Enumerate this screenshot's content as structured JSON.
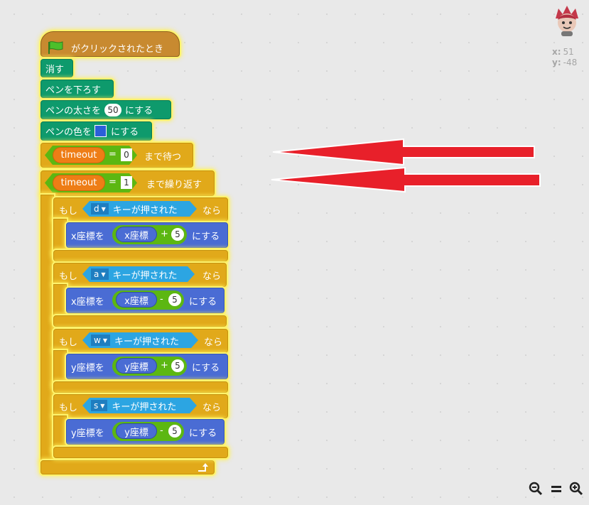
{
  "script": {
    "hat_label": "がクリックされたとき",
    "clear_label": "消す",
    "pen_down_label": "ペンを下ろす",
    "pen_size": {
      "prefix": "ペンの太さを",
      "value": "50",
      "suffix": "にする"
    },
    "pen_color": {
      "prefix": "ペンの色を",
      "suffix": "にする",
      "swatch_color": "#2b5fd9"
    },
    "wait_until": {
      "variable": "timeout",
      "operator": "=",
      "value": "0",
      "suffix": "まで待つ"
    },
    "repeat_until": {
      "variable": "timeout",
      "operator": "=",
      "value": "1",
      "suffix": "まで繰り返す"
    },
    "if_blocks": [
      {
        "if_label": "もし",
        "key": "d",
        "sensing_suffix": "キーが押された",
        "then_label": "なら",
        "target": "x座標を",
        "reporter": "x座標",
        "op": "+",
        "amount": "5",
        "suffix": "にする"
      },
      {
        "if_label": "もし",
        "key": "a",
        "sensing_suffix": "キーが押された",
        "then_label": "なら",
        "target": "x座標を",
        "reporter": "x座標",
        "op": "-",
        "amount": "5",
        "suffix": "にする"
      },
      {
        "if_label": "もし",
        "key": "w",
        "sensing_suffix": "キーが押された",
        "then_label": "なら",
        "target": "y座標を",
        "reporter": "y座標",
        "op": "+",
        "amount": "5",
        "suffix": "にする"
      },
      {
        "if_label": "もし",
        "key": "s",
        "sensing_suffix": "キーが押された",
        "then_label": "なら",
        "target": "y座標を",
        "reporter": "y座標",
        "op": "-",
        "amount": "5",
        "suffix": "にする"
      }
    ]
  },
  "sprite_info": {
    "x_label": "x:",
    "x_value": "51",
    "y_label": "y:",
    "y_value": "-48"
  },
  "zoom": {
    "zoom_out_icon": "zoom-out-icon",
    "reset_icon": "zoom-reset-icon",
    "zoom_in_icon": "zoom-in-icon"
  },
  "annotations": {
    "arrow_color": "#e8202a",
    "arrow_count": 2
  },
  "colors": {
    "events": "#c88a30",
    "pen": "#0e9a6c",
    "control": "#e1a91a",
    "motion": "#4a6cd4",
    "sensing": "#2ca5e2",
    "operators": "#5cb712",
    "variables": "#ee7d16"
  }
}
